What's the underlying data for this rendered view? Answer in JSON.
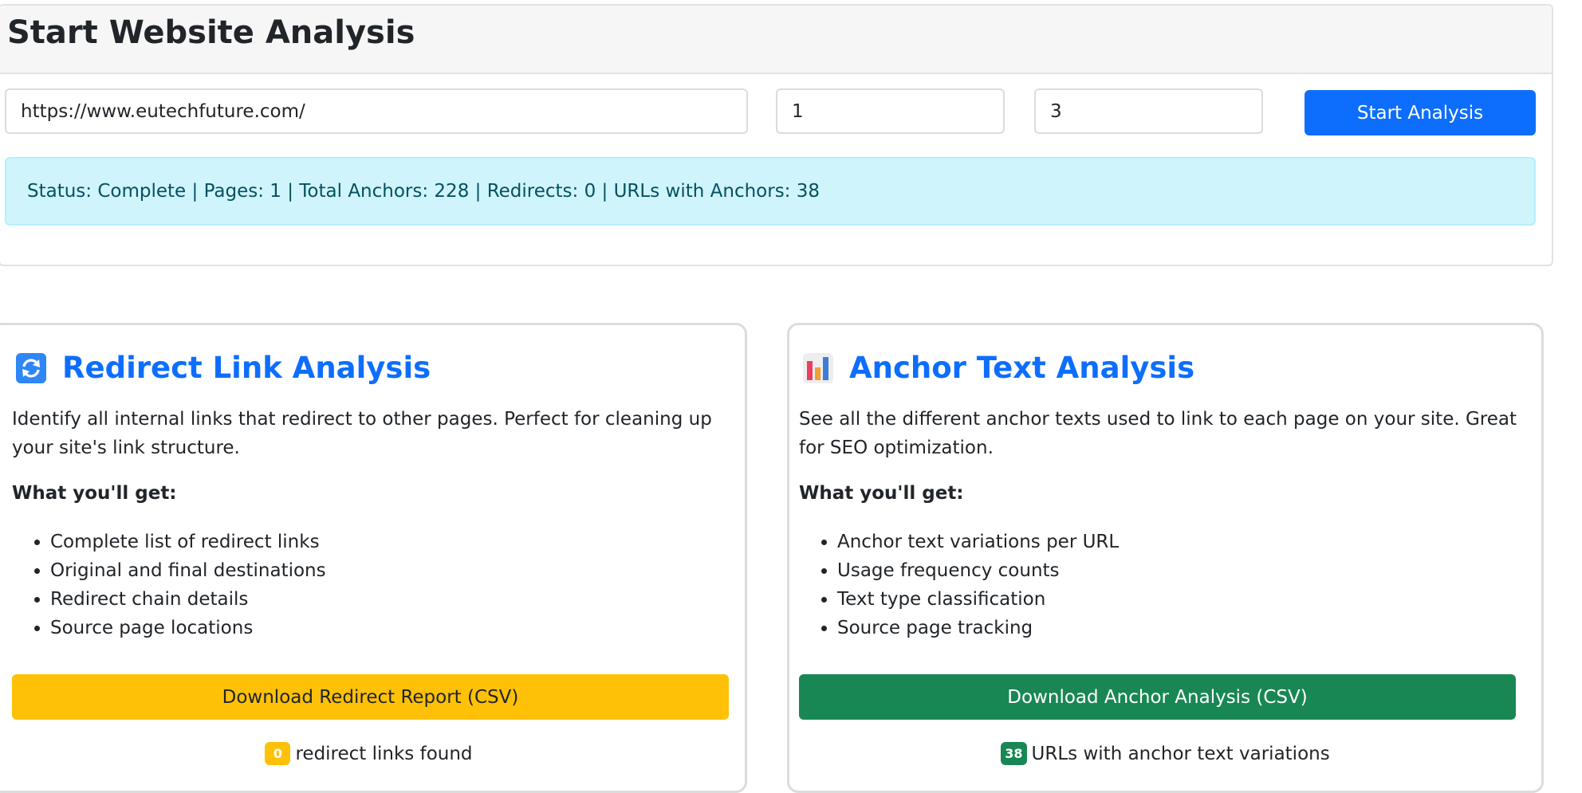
{
  "header": {
    "title": "Start Website Analysis"
  },
  "form": {
    "url_value": "https://www.eutechfuture.com/",
    "pages_value": "1",
    "depth_value": "3",
    "start_button_label": "Start Analysis"
  },
  "status": {
    "text": "Status: Complete | Pages: 1 | Total Anchors: 228 | Redirects: 0 | URLs with Anchors: 38"
  },
  "redirect_card": {
    "icon": "refresh-icon",
    "title": "Redirect Link Analysis",
    "description": "Identify all internal links that redirect to other pages. Perfect for cleaning up your site's link structure.",
    "subheading": "What you'll get:",
    "features": [
      "Complete list of redirect links",
      "Original and final destinations",
      "Redirect chain details",
      "Source page locations"
    ],
    "button_label": "Download Redirect Report (CSV)",
    "count": "0",
    "count_label": "redirect links found",
    "color": "#ffc107"
  },
  "anchor_card": {
    "icon": "bar-chart-icon",
    "title": "Anchor Text Analysis",
    "description": "See all the different anchor texts used to link to each page on your site. Great for SEO optimization.",
    "subheading": "What you'll get:",
    "features": [
      "Anchor text variations per URL",
      "Usage frequency counts",
      "Text type classification",
      "Source page tracking"
    ],
    "button_label": "Download Anchor Analysis (CSV)",
    "count": "38",
    "count_label": "URLs with anchor text variations",
    "color": "#198754"
  },
  "colors": {
    "primary": "#0d6efd",
    "info_bg": "#cff4fc",
    "info_text": "#055160",
    "warning": "#ffc107",
    "success": "#198754"
  }
}
